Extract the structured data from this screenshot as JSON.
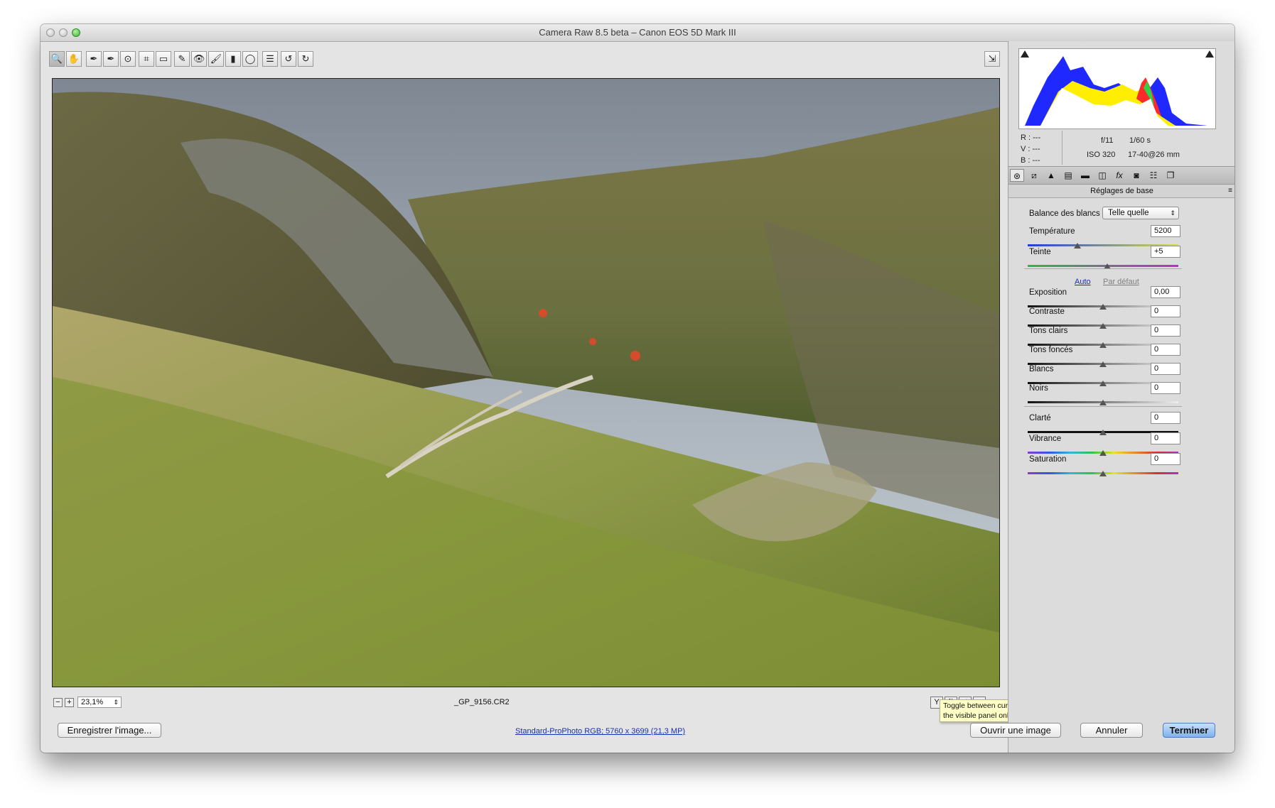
{
  "window": {
    "title": "Camera Raw 8.5 beta  –  Canon EOS 5D Mark III"
  },
  "toolbar": {
    "tools": [
      {
        "name": "zoom",
        "icon": "🔍"
      },
      {
        "name": "hand",
        "icon": "✋"
      },
      {
        "name": "white-balance",
        "icon": "✒"
      },
      {
        "name": "color-sampler",
        "icon": "✒"
      },
      {
        "name": "targeted-adjustment",
        "icon": "⊙"
      },
      {
        "name": "crop",
        "icon": "⌗"
      },
      {
        "name": "straighten",
        "icon": "▭"
      },
      {
        "name": "spot-removal",
        "icon": "✎"
      },
      {
        "name": "red-eye",
        "icon": "👁"
      },
      {
        "name": "adjustment-brush",
        "icon": "🖌"
      },
      {
        "name": "graduated-filter",
        "icon": "▮"
      },
      {
        "name": "radial-filter",
        "icon": "◯"
      },
      {
        "name": "preferences",
        "icon": "☰"
      },
      {
        "name": "rotate-left",
        "icon": "↺"
      },
      {
        "name": "rotate-right",
        "icon": "↻"
      }
    ],
    "fullscreen_icon": "⇲"
  },
  "status": {
    "zoom_value": "23,1%",
    "filename": "_GP_9156.CR2",
    "view_icons": [
      "Y",
      "⇅",
      "⇄",
      "≡"
    ]
  },
  "tooltip": {
    "line1": "Toggle between current settings and defaults for",
    "line2": "the visible panel only (Command-Option-P)."
  },
  "histogram": {
    "rgb": {
      "r": "R :  ---",
      "v": "V :  ---",
      "b": "B :  ---"
    },
    "aperture": "f/11",
    "shutter": "1/60 s",
    "iso": "ISO 320",
    "lens": "17-40@26 mm"
  },
  "panel": {
    "title": "Réglages de base",
    "white_balance_label": "Balance des blancs :",
    "white_balance_value": "Telle quelle",
    "auto": "Auto",
    "default": "Par défaut",
    "sliders_top": [
      {
        "label": "Température",
        "value": "5200",
        "position": 0.33,
        "track": "temp"
      },
      {
        "label": "Teinte",
        "value": "+5",
        "position": 0.53,
        "track": "tint"
      }
    ],
    "sliders_tone": [
      {
        "label": "Exposition",
        "value": "0,00",
        "position": 0.5
      },
      {
        "label": "Contraste",
        "value": "0",
        "position": 0.5
      },
      {
        "label": "Tons clairs",
        "value": "0",
        "position": 0.5
      },
      {
        "label": "Tons foncés",
        "value": "0",
        "position": 0.5
      },
      {
        "label": "Blancs",
        "value": "0",
        "position": 0.5
      },
      {
        "label": "Noirs",
        "value": "0",
        "position": 0.5
      }
    ],
    "sliders_presence": [
      {
        "label": "Clarté",
        "value": "0",
        "position": 0.5,
        "track": "plain"
      },
      {
        "label": "Vibrance",
        "value": "0",
        "position": 0.5,
        "track": "rainbow"
      },
      {
        "label": "Saturation",
        "value": "0",
        "position": 0.5,
        "track": "rainbow"
      }
    ]
  },
  "bottom": {
    "save_label": "Enregistrer l'image...",
    "workflow_link": "Standard-ProPhoto RGB; 5760 x 3699 (21,3 MP)",
    "open_label": "Ouvrir une image",
    "cancel_label": "Annuler",
    "done_label": "Terminer"
  },
  "colors": {
    "accent": "#2a5bd7",
    "link": "#1b2fb4"
  }
}
